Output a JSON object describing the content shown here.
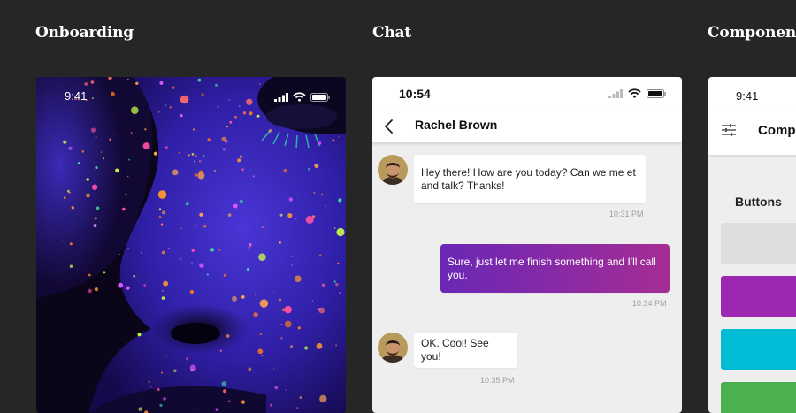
{
  "sections": {
    "onboarding": "Onboarding",
    "chat": "Chat",
    "components": "Components"
  },
  "onboarding": {
    "status_time": "9:41",
    "icons": [
      "signal-icon",
      "wifi-icon",
      "battery-icon"
    ]
  },
  "chat": {
    "status_time": "10:54",
    "contact_name": "Rachel Brown",
    "accent_gradient": [
      "#6a27b6",
      "#a52d94"
    ],
    "messages": [
      {
        "direction": "in",
        "text": "Hey there! How are you today? Can we me et and talk? Thanks!",
        "time": "10:31 PM"
      },
      {
        "direction": "out",
        "text": "Sure, just let me finish something and I'll call you.",
        "time": "10:34 PM"
      },
      {
        "direction": "in",
        "text": "OK. Cool! See you!",
        "time": "10:35 PM"
      }
    ]
  },
  "components": {
    "status_time": "9:41",
    "title": "Components",
    "section_label": "Buttons",
    "button_colors": [
      "#dedede",
      "#9c27b0",
      "#00bcd4",
      "#4caf50"
    ]
  }
}
